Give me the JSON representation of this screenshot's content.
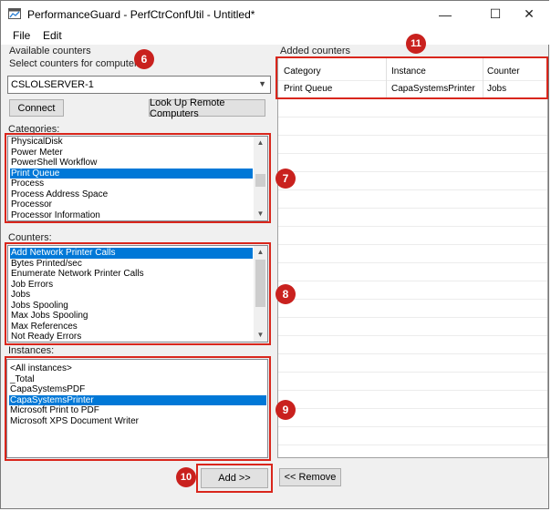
{
  "window": {
    "title": "PerformanceGuard - PerfCtrConfUtil - Untitled*",
    "minimize": "—",
    "maximize": "☐",
    "close": "✕"
  },
  "menu": [
    "File",
    "Edit"
  ],
  "left": {
    "available_counters_label": "Available counters",
    "select_computer_label": "Select counters for computer:",
    "computer_value": "CSLOLSERVER-1",
    "connect_label": "Connect",
    "lookup_label": "Look Up Remote Computers",
    "categories_label": "Categories:",
    "categories": [
      "PhysicalDisk",
      "Power Meter",
      "PowerShell Workflow",
      "Print Queue",
      "Process",
      "Process Address Space",
      "Processor",
      "Processor Information"
    ],
    "categories_selected": "Print Queue",
    "counters_label": "Counters:",
    "counters": [
      "Add Network Printer Calls",
      "Bytes Printed/sec",
      "Enumerate Network Printer Calls",
      "Job Errors",
      "Jobs",
      "Jobs Spooling",
      "Max Jobs Spooling",
      "Max References",
      "Not Ready Errors"
    ],
    "counters_selected": "Add Network Printer Calls",
    "instances_label": "Instances:",
    "instances": [
      "<All instances>",
      "_Total",
      "CapaSystemsPDF",
      "CapaSystemsPrinter",
      "Microsoft Print to PDF",
      "Microsoft XPS Document Writer"
    ],
    "instances_selected": "CapaSystemsPrinter",
    "add_label": "Add >>"
  },
  "right": {
    "added_counters_label": "Added counters",
    "columns": [
      "Category",
      "Instance",
      "Counter"
    ],
    "rows": [
      [
        "Print Queue",
        "CapaSystemsPrinter",
        "Jobs"
      ]
    ],
    "remove_label": "<< Remove"
  },
  "callouts": [
    "6",
    "7",
    "8",
    "9",
    "10",
    "11"
  ],
  "colors": {
    "selection": "#0078d7",
    "callout": "#c9211e"
  }
}
